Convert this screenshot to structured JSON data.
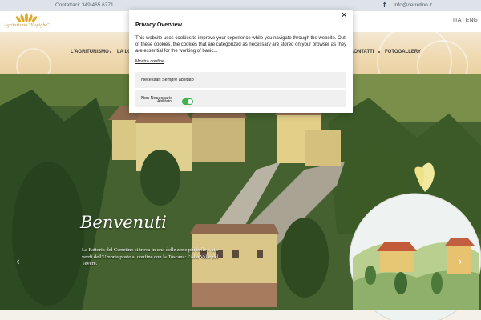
{
  "topbar": {
    "contacts": "Contattaci: 349 465 6771",
    "facebook_icon": "facebook-icon",
    "email": "Info@cerretino.it"
  },
  "header": {
    "logo_text": "Agriturismo \"Il spighe\"",
    "lang": "ITA | ENG"
  },
  "nav": {
    "items": [
      "L'AGRITURISMO",
      "LA LO",
      "CONTATTI",
      "FOTOGALLERY"
    ]
  },
  "hero": {
    "title": "Benvenuti",
    "text": "La Fattoria del Cerretino si trova in una delle zone più belle e più verdi dell'Umbria poste al confine con la Toscana: l'Alta Valle del Tevere.",
    "prev_icon": "chevron-left-icon",
    "next_icon": "chevron-right-icon"
  },
  "privacy": {
    "title": "Privacy Overview",
    "close_icon": "close-icon",
    "description": "This website uses cookies to improve your experience while you navigate through the website. Out of these cookies, the cookies that are categorized as necessary are stored on your browser as they are essential for the working of basic...",
    "show_more": "Mostra confine",
    "necessary_label": "Necessari Sempre abilitato",
    "non_necessary_label": "Non Necessario",
    "toggle_label": "Abilitato",
    "toggle_on": true,
    "toggle_color": "#3fb24c"
  }
}
